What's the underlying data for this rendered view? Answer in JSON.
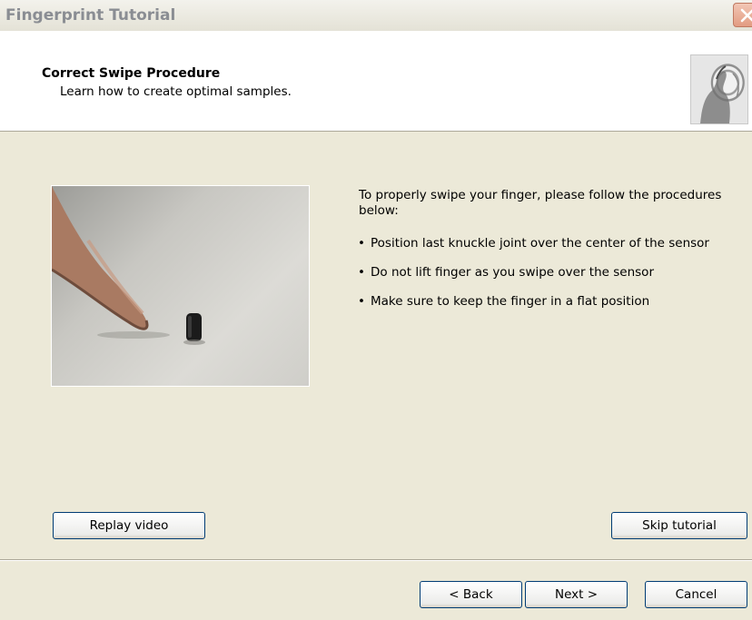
{
  "window": {
    "title": "Fingerprint Tutorial",
    "close_icon": "close-icon"
  },
  "header": {
    "title": "Correct Swipe Procedure",
    "subtitle": "Learn how to create optimal samples.",
    "image_icon": "fingerprint-hand-image"
  },
  "video": {
    "icon": "finger-on-sensor-video"
  },
  "instructions": {
    "intro": "To properly swipe your finger, please follow the procedures below:",
    "bullet_glyph": "•",
    "bullets": [
      "Position last knuckle joint over the center of the sensor",
      "Do not lift finger as you swipe over the sensor",
      "Make sure to keep the finger in a flat position"
    ]
  },
  "buttons": {
    "replay": "Replay video",
    "skip": "Skip tutorial",
    "back": "< Back",
    "next": "Next >",
    "cancel": "Cancel"
  },
  "colors": {
    "dialog_bg": "#ece9d8",
    "button_border": "#003c74",
    "title_text": "#8a8d93",
    "close_button": "#e29c82"
  }
}
